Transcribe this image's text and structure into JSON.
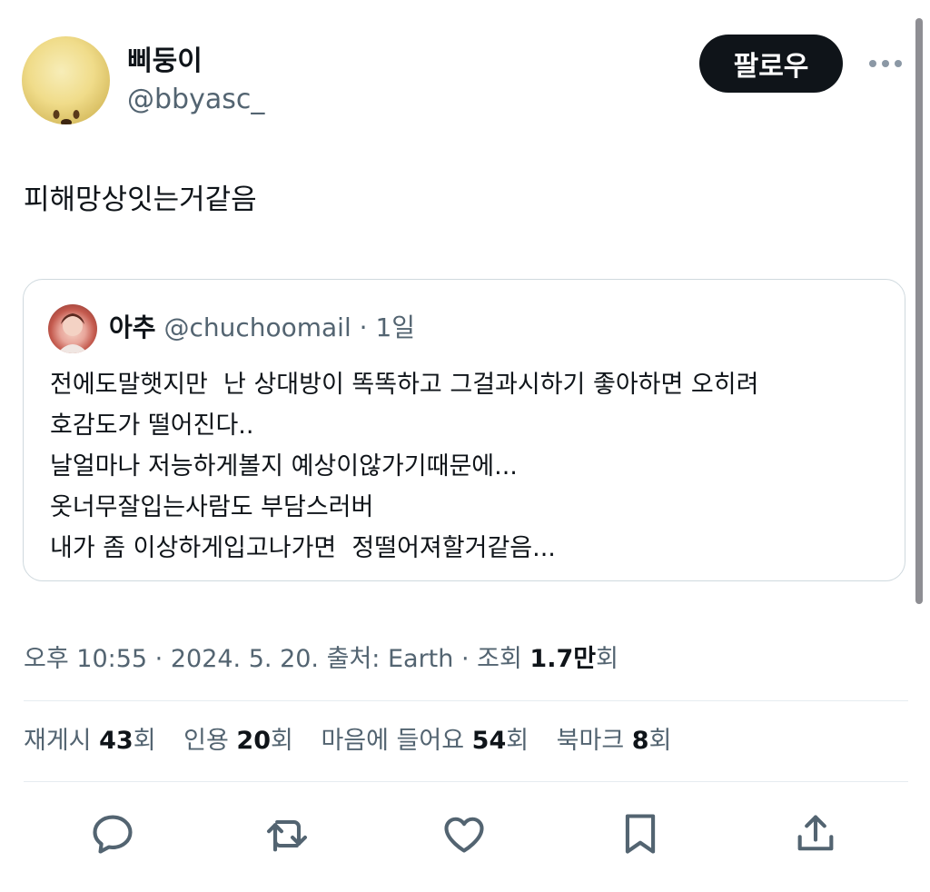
{
  "author": {
    "display_name": "삐둥이",
    "handle": "@bbyasc_",
    "avatar_icon": "yellow-dog-face-avatar"
  },
  "follow_button": {
    "label": "팔로우"
  },
  "more_icon": "more-horizontal-icon",
  "tweet": {
    "text": "피해망상잇는거같음"
  },
  "quote": {
    "author_name": "아추",
    "author_handle": "@chuchoomail",
    "time": "1일",
    "lines": [
      "전에도말햇지만  난 상대방이 똑똑하고 그걸과시하기 좋아하면 오히려",
      "호감도가 떨어진다..",
      "날얼마나 저능하게볼지 예상이않가기때문에...",
      "옷너무잘입는사람도 부담스러버",
      "내가 좀 이상하게입고나가면  정떨어져할거같음..."
    ]
  },
  "timestamp": {
    "time": "오후 10:55",
    "date": "2024. 5. 20.",
    "source": "출처: Earth",
    "views_label": "조회",
    "views_count": "1.7만",
    "views_suffix": "회"
  },
  "stats": {
    "retweets": {
      "label": "재게시",
      "count": "43",
      "suffix": "회"
    },
    "quotes": {
      "label": "인용",
      "count": "20",
      "suffix": "회"
    },
    "likes": {
      "label": "마음에 들어요",
      "count": "54",
      "suffix": "회"
    },
    "bookmarks": {
      "label": "북마크",
      "count": "8",
      "suffix": "회"
    }
  },
  "actions": [
    "reply-icon",
    "retweet-icon",
    "like-icon",
    "bookmark-icon",
    "share-icon"
  ],
  "colors": {
    "text": "#0f1419",
    "secondary": "#536471",
    "border": "#cfd9de",
    "button_bg": "#0f1419"
  }
}
